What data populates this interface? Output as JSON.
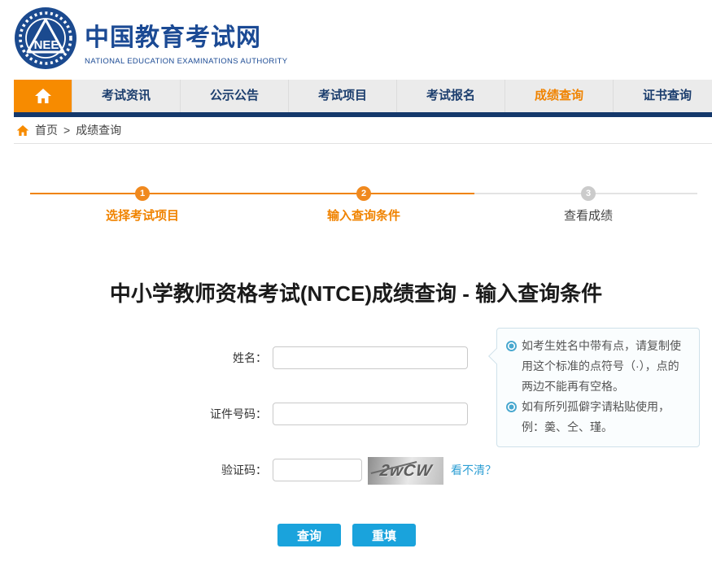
{
  "header": {
    "logo_letters": "NEE",
    "site_name": "中国教育考试网",
    "site_subtitle": "NATIONAL EDUCATION EXAMINATIONS AUTHORITY"
  },
  "nav": {
    "items": [
      {
        "label": "考试资讯",
        "active": false
      },
      {
        "label": "公示公告",
        "active": false
      },
      {
        "label": "考试项目",
        "active": false
      },
      {
        "label": "考试报名",
        "active": false
      },
      {
        "label": "成绩查询",
        "active": true
      },
      {
        "label": "证书查询",
        "active": false
      }
    ]
  },
  "breadcrumb": {
    "home": "首页",
    "separator": ">",
    "current": "成绩查询"
  },
  "steps": [
    {
      "num": "1",
      "label": "选择考试项目",
      "state": "done"
    },
    {
      "num": "2",
      "label": "输入查询条件",
      "state": "active"
    },
    {
      "num": "3",
      "label": "查看成绩",
      "state": "pending"
    }
  ],
  "main": {
    "title": "中小学教师资格考试(NTCE)成绩查询 - 输入查询条件"
  },
  "form": {
    "name_label": "姓名：",
    "name_value": "",
    "id_label": "证件号码：",
    "id_value": "",
    "captcha_label": "验证码：",
    "captcha_value": "",
    "captcha_image_text": "2wCW",
    "refresh_link": "看不清？",
    "query_button": "查询",
    "reset_button": "重填"
  },
  "tooltip": {
    "items": [
      "如考生姓名中带有点，请复制使用这个标准的点符号（·），点的两边不能再有空格。",
      "如有所列孤僻字请粘贴使用，例：羮、仝、瑾。"
    ]
  },
  "colors": {
    "brand_blue": "#1b4a94",
    "nav_strip_navy": "#14386b",
    "accent_orange": "#f78b00",
    "highlight_orange": "#f08300",
    "button_blue": "#1aa3dc",
    "link_blue": "#2e9fd4"
  }
}
